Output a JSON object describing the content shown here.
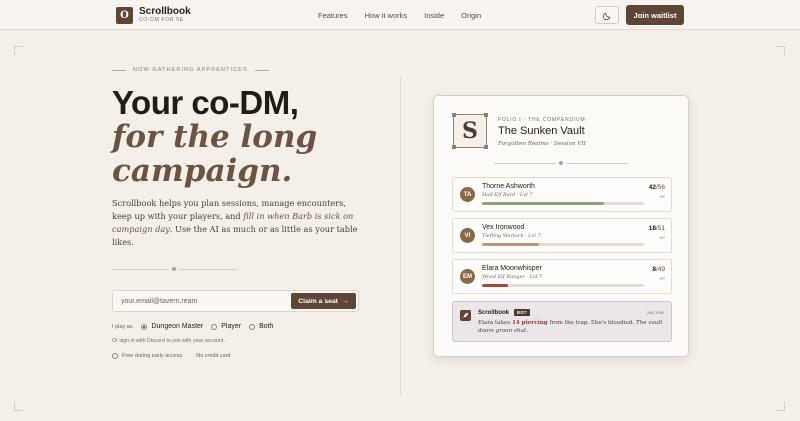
{
  "brand": {
    "logo_letter": "O",
    "name": "Scrollbook",
    "tagline": "CO-DM FOR 5E"
  },
  "nav": {
    "items": [
      "Features",
      "How it works",
      "Inside",
      "Origin"
    ]
  },
  "header": {
    "theme_icon": "moon-icon",
    "waitlist_label": "Join waitlist"
  },
  "hero": {
    "eyebrow": "NOW GATHERING APPRENTICES",
    "title_line1": "Your co-DM,",
    "title_line2": "for the long",
    "title_line3": "campaign.",
    "lede_part1": "Scrollbook helps you plan sessions, manage encounters, keep up with your players, and ",
    "lede_emphasis": "fill in when Barb is sick on campaign day",
    "lede_part2": ". Use the AI as much or as little as your table likes."
  },
  "signup": {
    "email_placeholder": "your.email@tavern.ream",
    "cta_label": "Claim a seat",
    "cta_icon": "arrow-right-icon",
    "play_as_label": "I play as",
    "options": [
      "Dungeon Master",
      "Player",
      "Both"
    ],
    "selected_option": "Dungeon Master",
    "discord_note": "Or sign in with Discord to join with your account.",
    "perk1": "Free during early access",
    "perk2": "No credit card"
  },
  "card": {
    "seal_letter": "S",
    "folio": "FOLIO I · THE COMPENDIUM",
    "title": "The Sunken Vault",
    "subtitle": "Forgotten Realms · Session VII",
    "party": [
      {
        "initials": "TA",
        "name": "Thorne Ashworth",
        "class": "Half-Elf Bard · Lvl 7",
        "hp": "42",
        "hp_max": "/56",
        "hp_label": "HP",
        "hp_fraction": 0.75,
        "bar_color": "#8fa37a"
      },
      {
        "initials": "VI",
        "name": "Vex Ironwood",
        "class": "Tiefling Warlock · Lvl 7",
        "hp": "18",
        "hp_max": "/51",
        "hp_label": "HP",
        "hp_fraction": 0.35,
        "bar_color": "#b89878"
      },
      {
        "initials": "EM",
        "name": "Elara Moonwhisper",
        "class": "Wood Elf Ranger · Lvl 7",
        "hp": "8",
        "hp_max": "/49",
        "hp_label": "HP",
        "hp_fraction": 0.16,
        "bar_color": "#a6443a"
      }
    ],
    "message": {
      "icon": "feather-icon",
      "author": "Scrollbook",
      "badge": "BOT",
      "time": "just now",
      "text_start": "Elara takes ",
      "damage": "14 piercing",
      "text_mid": " from the trap. She's bloodied. ",
      "text_italic": "The vault doors groan shut."
    }
  },
  "colors": {
    "brand": "#5e4637",
    "background": "#f4efe8",
    "accent_text": "#6b5443"
  }
}
